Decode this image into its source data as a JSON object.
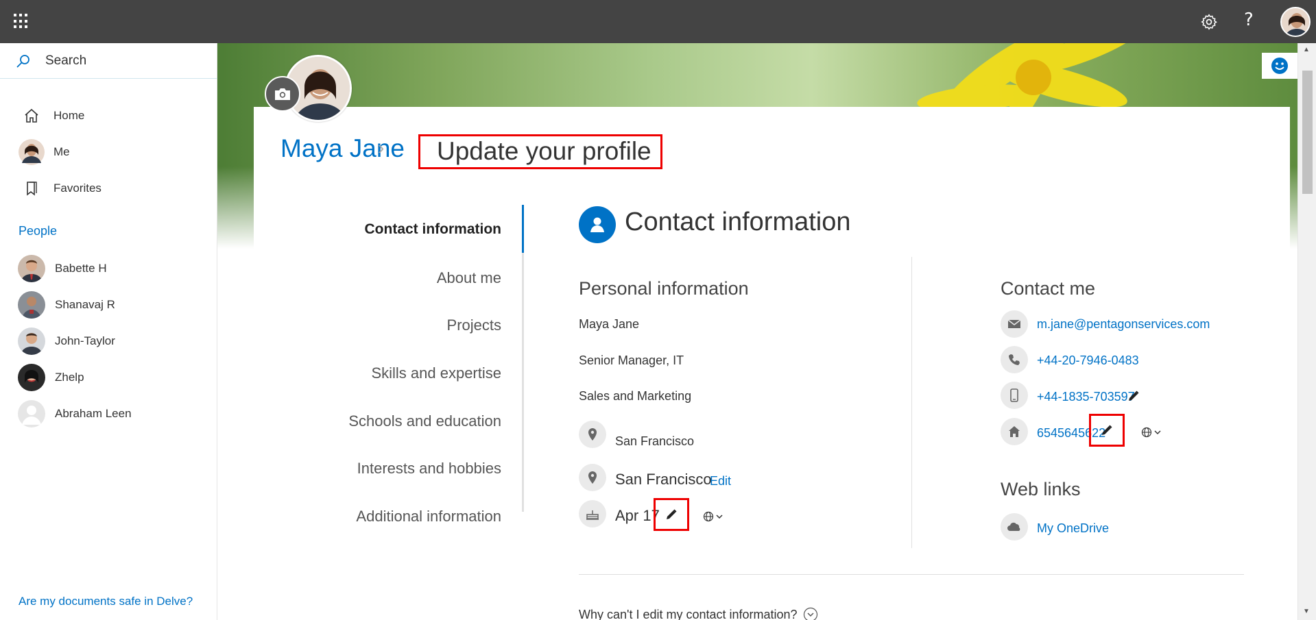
{
  "topbar": {
    "help_label": "?"
  },
  "search": {
    "placeholder": "Search"
  },
  "nav": {
    "home": "Home",
    "me": "Me",
    "favorites": "Favorites"
  },
  "people": {
    "title": "People",
    "items": [
      "Babette H",
      "Shanavaj R",
      "John-Taylor",
      "Zhelp",
      "Abraham Leen"
    ]
  },
  "footer_link": "Are my documents safe in Delve?",
  "breadcrumb": {
    "name": "Maya Jane",
    "separator": "›",
    "page": "Update your profile"
  },
  "tabs": [
    "Contact information",
    "About me",
    "Projects",
    "Skills and expertise",
    "Schools and education",
    "Interests and hobbies",
    "Additional information"
  ],
  "section_title": "Contact information",
  "personal": {
    "heading": "Personal information",
    "name": "Maya Jane",
    "title": "Senior Manager, IT",
    "department": "Sales and Marketing",
    "office_location": "San Francisco",
    "home_location": "San Francisco",
    "edit_label": "Edit",
    "birthday": "Apr 17"
  },
  "contact": {
    "heading": "Contact me",
    "email": "m.jane@pentagonservices.com",
    "work_phone": "+44-20-7946-0483",
    "mobile_phone": "+44-1835-703597",
    "home_phone": "6545645622"
  },
  "weblinks": {
    "heading": "Web links",
    "onedrive": "My OneDrive"
  },
  "why_link": "Why can't I edit my contact information?",
  "colors": {
    "accent": "#0072c6",
    "highlight_box": "#ee0000",
    "topbar": "#444444"
  }
}
